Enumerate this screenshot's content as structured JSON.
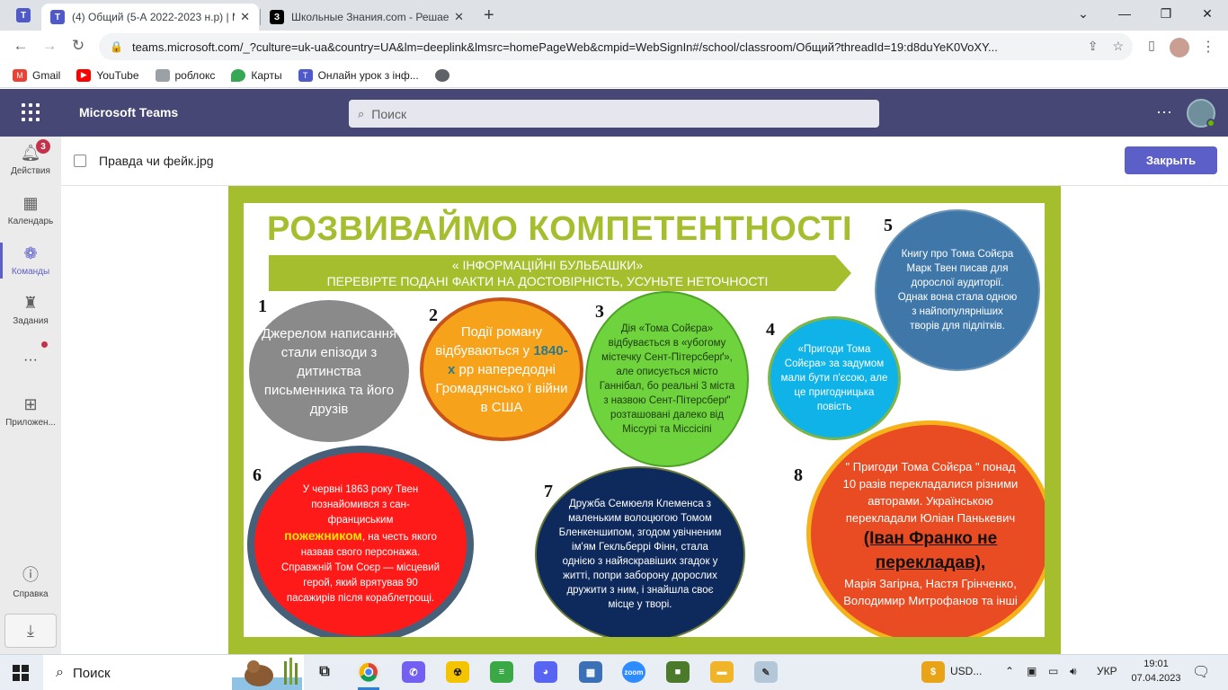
{
  "browser": {
    "tabs": [
      {
        "title": "(4) Общий (5-А 2022-2023 н.р) | M",
        "close": "✕"
      },
      {
        "title": "Школьные Знания.com - Решае",
        "close": "✕"
      }
    ],
    "new_tab": "+",
    "window_controls": {
      "dropdown": "⌄",
      "minimize": "—",
      "maximize": "❐",
      "close": "✕"
    },
    "url": "teams.microsoft.com/_?culture=uk-ua&country=UA&lm=deeplink&lmsrc=homePageWeb&cmpid=WebSignIn#/school/classroom/Общий?threadId=19:d8duYeK0VoXY...",
    "bookmarks": [
      "Gmail",
      "YouTube",
      "роблокс",
      "Карты",
      "Онлайн урок з інф..."
    ]
  },
  "teams": {
    "app_name": "Microsoft Teams",
    "search_placeholder": "Поиск",
    "more": "···",
    "rail": [
      {
        "label": "Действия",
        "badge": "3"
      },
      {
        "label": "Календарь"
      },
      {
        "label": "Команды"
      },
      {
        "label": "Задания"
      },
      {
        "label": "···"
      },
      {
        "label": "Приложен..."
      },
      {
        "label": "Справка"
      }
    ],
    "viewer": {
      "filename": "Правда чи фейк.jpg",
      "close_label": "Закрыть"
    }
  },
  "poster": {
    "title": "РОЗВИВАЙМО КОМПЕТЕНТНОСТІ",
    "banner_line1": "« ІНФОРМАЦІЙНІ БУЛЬБАШКИ»",
    "banner_line2": "ПЕРЕВІРТЕ ПОДАНІ ФАКТИ НА ДОСТОВІРНІСТЬ, УСУНЬТЕ НЕТОЧНОСТІ",
    "numbers": [
      "1",
      "2",
      "3",
      "4",
      "5",
      "6",
      "7",
      "8"
    ],
    "c1": "Джерелом написання стали епізоди з дитинства письменника та його друзів",
    "c2_pre": "Події роману відбуваються у ",
    "c2_hl": "1840-х",
    "c2_post": " рр напередодні Громадянсько ї війни  в США",
    "c3": "Дія «Тома Сойєра» відбувається в «убогому містечку Сент-Пітерсберґ», але описується місто Ганнібал, бо реальні 3 міста з назвою Сент-Пітерсберґ' розташовані далеко від Міссурі та Міссісіпі",
    "c4": "«Пригоди Тома Сойєра» за задумом мали бути п'єсою, але це пригодницька повість",
    "c5": "Книгу про Тома Сойєра Марк Твен писав для дорослої аудиторії. Однак вона стала одною з найпопулярніших творів для підлітків.",
    "c6_pre": "У червні 1863 року Твен познайомився з сан-франциським",
    "c6_hl": "пожежником",
    "c6_post": ", на честь якого назвав свого персонажа. Справжній Том Соєр — місцевий герой, який врятував 90 пасажирів після кораблетрощі.",
    "c7": "Дружба Семюеля Клеменса з маленьким волоцюгою Томом Бленкеншипом, згодом увічненим ім'ям Гекльберрі Фінн, стала однією з найяскравіших згадок у житті, попри заборону дорослих дружити з ним, і знайшла своє місце у творі.",
    "c8_pre": "\" Пригоди Тома Сойєра \" понад 10 разів перекладалися різними авторами. Українською перекладали Юліан Панькевич",
    "c8_hl": "(Іван Франко не перекладав),",
    "c8_post": "Марія Загірна,  Настя Грінченко, Володимир Митрофанов та інші"
  },
  "taskbar": {
    "search": "Поиск",
    "currency": "USD...",
    "lang": "УКР",
    "time": "19:01",
    "date": "07.04.2023"
  },
  "colors": {
    "teams_header": "#464775",
    "teams_accent": "#5b5fc7",
    "poster_frame": "#a5be2e"
  }
}
